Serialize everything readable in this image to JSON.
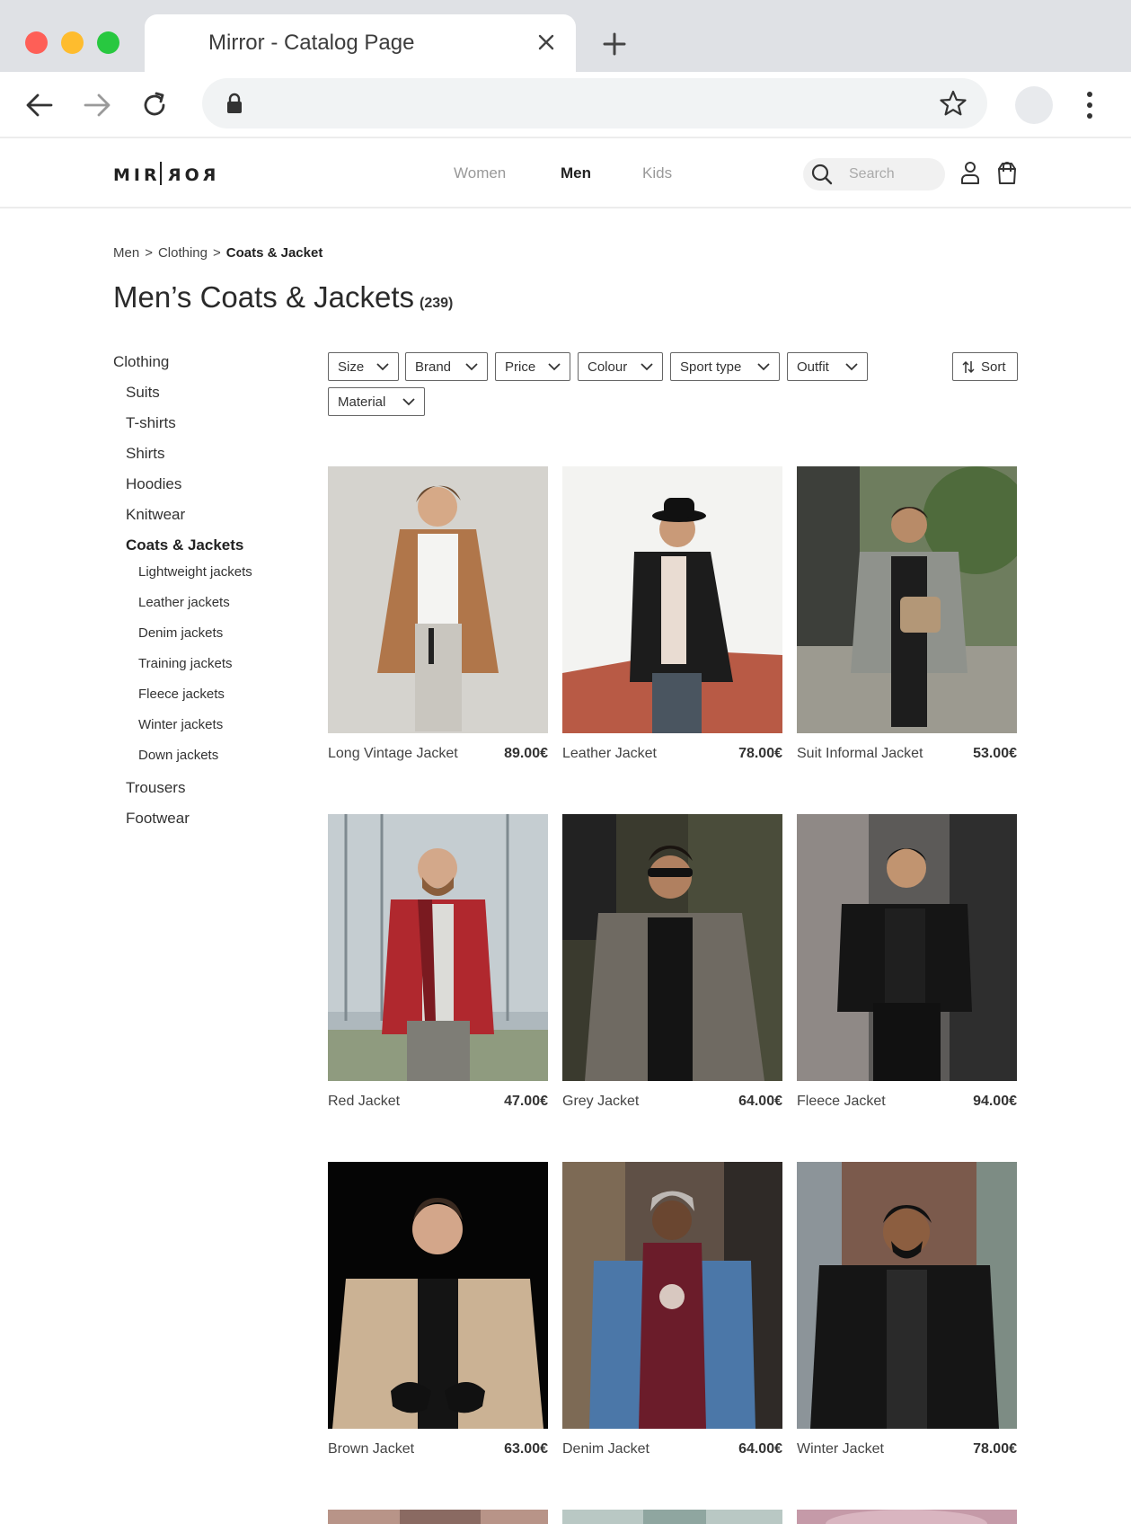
{
  "browser": {
    "tab_title": "Mirror - Catalog Page",
    "icons": [
      "close-icon",
      "plus-icon",
      "back-icon",
      "forward-icon",
      "reload-icon",
      "lock-icon",
      "star-icon",
      "kebab-menu-icon"
    ]
  },
  "header": {
    "logo_left": "MIR",
    "logo_right": "ROR",
    "nav": [
      "Women",
      "Men",
      "Kids"
    ],
    "active_nav": "Men",
    "search_placeholder": "Search",
    "icons": [
      "search-icon",
      "user-icon",
      "shopping-bag-icon"
    ]
  },
  "breadcrumb": {
    "items": [
      "Men",
      "Clothing",
      "Coats & Jacket"
    ],
    "separator": ">"
  },
  "page": {
    "title": "Men’s Coats & Jackets",
    "count": "(239)"
  },
  "sidebar": {
    "items": [
      {
        "label": "Clothing",
        "level": 0
      },
      {
        "label": "Suits",
        "level": 1
      },
      {
        "label": "T-shirts",
        "level": 1
      },
      {
        "label": "Shirts",
        "level": 1
      },
      {
        "label": "Hoodies",
        "level": 1
      },
      {
        "label": "Knitwear",
        "level": 1
      },
      {
        "label": "Coats & Jackets",
        "level": 1,
        "active": true
      },
      {
        "label": "Lightweight jackets",
        "level": 2
      },
      {
        "label": "Leather jackets",
        "level": 2
      },
      {
        "label": "Denim jackets",
        "level": 2
      },
      {
        "label": "Training jackets",
        "level": 2
      },
      {
        "label": "Fleece jackets",
        "level": 2
      },
      {
        "label": "Winter jackets",
        "level": 2
      },
      {
        "label": "Down jackets",
        "level": 2
      },
      {
        "label": "Trousers",
        "level": 1
      },
      {
        "label": "Footwear",
        "level": 1
      }
    ]
  },
  "filters": {
    "items": [
      "Size",
      "Brand",
      "Price",
      "Colour",
      "Sport type",
      "Outfit",
      "Material"
    ],
    "sort_label": "Sort"
  },
  "products": [
    {
      "name": "Long Vintage Jacket",
      "price": "89.00€"
    },
    {
      "name": "Leather Jacket",
      "price": "78.00€"
    },
    {
      "name": "Suit Informal Jacket",
      "price": "53.00€"
    },
    {
      "name": "Red Jacket",
      "price": "47.00€"
    },
    {
      "name": "Grey Jacket",
      "price": "64.00€"
    },
    {
      "name": "Fleece Jacket",
      "price": "94.00€"
    },
    {
      "name": "Brown Jacket",
      "price": "63.00€"
    },
    {
      "name": "Denim Jacket",
      "price": "64.00€"
    },
    {
      "name": "Winter Jacket",
      "price": "78.00€"
    }
  ],
  "colors": {
    "tabbar": "#dfe1e5",
    "traffic_red": "#fe5f57",
    "traffic_yellow": "#febc2e",
    "traffic_green": "#28c840",
    "text_primary": "#222222",
    "text_muted": "#999999"
  }
}
